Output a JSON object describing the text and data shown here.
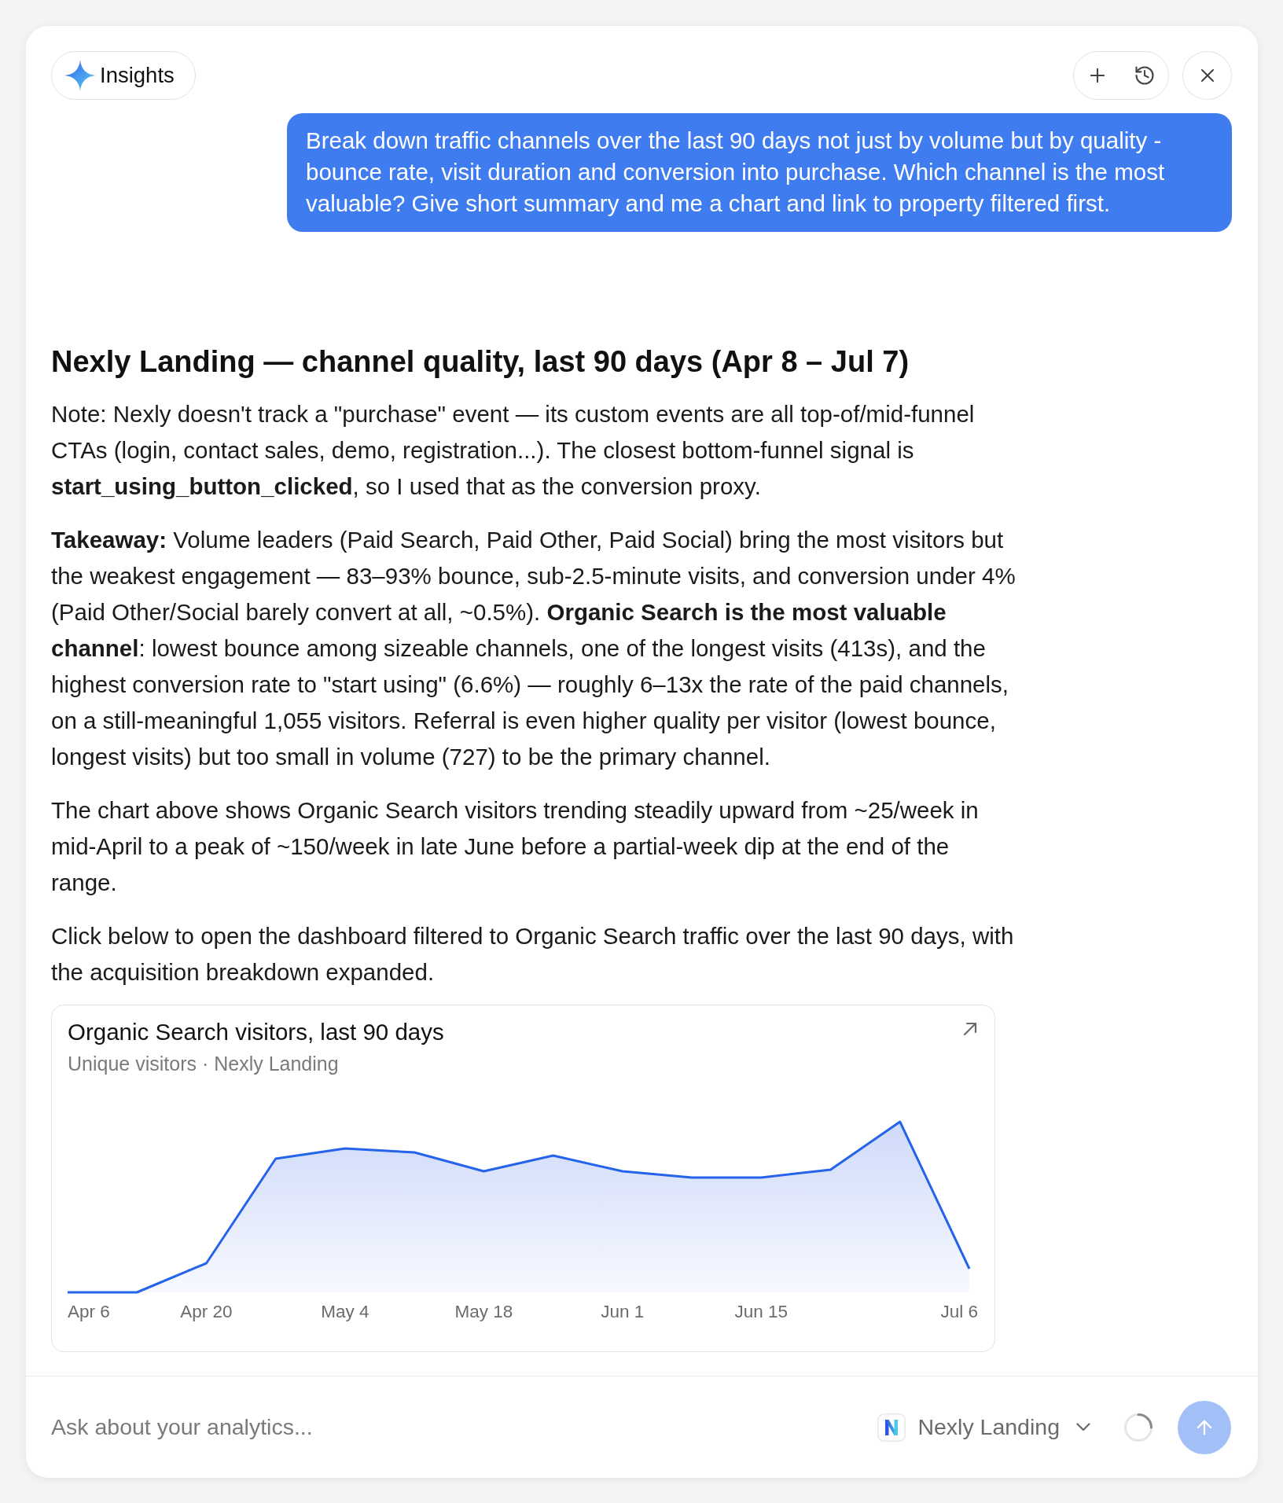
{
  "header": {
    "badge": "Insights"
  },
  "user_message": "Break down traffic channels over the last 90 days not just by volume but by quality - bounce rate, visit duration and conversion into purchase. Which channel is the most valuable? Give short summary and me a chart and link to property filtered first.",
  "response": {
    "heading": "Nexly Landing — channel quality, last 90 days (Apr 8 – Jul 7)",
    "paragraphs": [
      "Note: Nexly doesn't track a \"purchase\" event — its custom events are all top-of/mid-funnel CTAs (login, contact sales, demo, registration...). The closest bottom-funnel signal is **start_using_button_clicked**, so I used that as the conversion proxy.",
      "**Takeaway:** Volume leaders (Paid Search, Paid Other, Paid Social) bring the most visitors but the weakest engagement — 83–93% bounce, sub-2.5-minute visits, and conversion under 4% (Paid Other/Social barely convert at all, ~0.5%). **Organic Search is the most valuable channel**: lowest bounce among sizeable channels, one of the longest visits (413s), and the highest conversion rate to \"start using\" (6.6%) — roughly 6–13x the rate of the paid channels, on a still-meaningful 1,055 visitors. Referral is even higher quality per visitor (lowest bounce, longest visits) but too small in volume (727) to be the primary channel.",
      "The chart above shows Organic Search visitors trending steadily upward from ~25/week in mid-April to a peak of ~150/week in late June before a partial-week dip at the end of the range.",
      "Click below to open the dashboard filtered to Organic Search traffic over the last 90 days, with the acquisition breakdown expanded."
    ]
  },
  "chart_card": {
    "title": "Organic Search visitors, last 90 days",
    "subtitle": "Unique visitors · Nexly Landing",
    "x_labels": [
      "Apr 6",
      "Apr 20",
      "May 4",
      "May 18",
      "Jun 1",
      "Jun 15",
      "Jul 6"
    ]
  },
  "composer": {
    "placeholder": "Ask about your analytics...",
    "property": "Nexly Landing",
    "loading": true,
    "send_disabled": true
  }
}
